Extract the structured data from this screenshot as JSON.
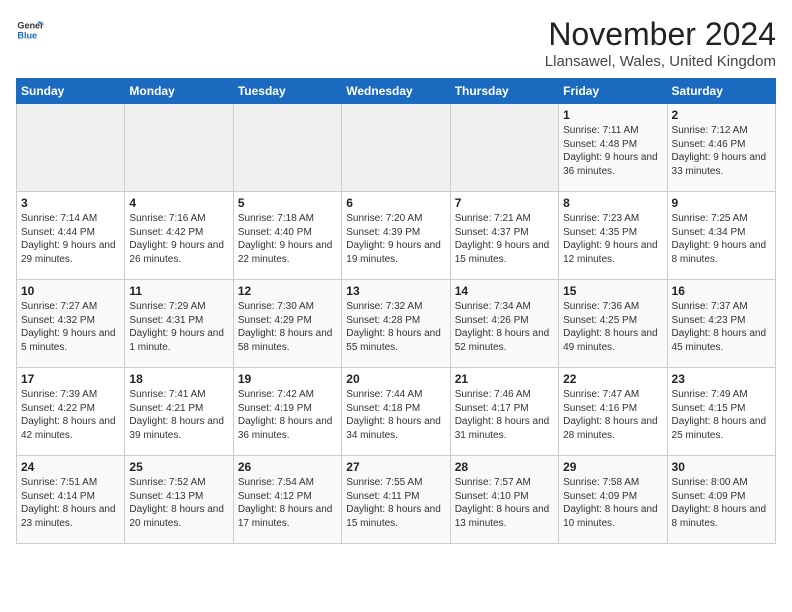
{
  "logo": {
    "general": "General",
    "blue": "Blue"
  },
  "title": "November 2024",
  "subtitle": "Llansawel, Wales, United Kingdom",
  "days_of_week": [
    "Sunday",
    "Monday",
    "Tuesday",
    "Wednesday",
    "Thursday",
    "Friday",
    "Saturday"
  ],
  "weeks": [
    [
      {
        "day": "",
        "detail": ""
      },
      {
        "day": "",
        "detail": ""
      },
      {
        "day": "",
        "detail": ""
      },
      {
        "day": "",
        "detail": ""
      },
      {
        "day": "",
        "detail": ""
      },
      {
        "day": "1",
        "detail": "Sunrise: 7:11 AM\nSunset: 4:48 PM\nDaylight: 9 hours and 36 minutes."
      },
      {
        "day": "2",
        "detail": "Sunrise: 7:12 AM\nSunset: 4:46 PM\nDaylight: 9 hours and 33 minutes."
      }
    ],
    [
      {
        "day": "3",
        "detail": "Sunrise: 7:14 AM\nSunset: 4:44 PM\nDaylight: 9 hours and 29 minutes."
      },
      {
        "day": "4",
        "detail": "Sunrise: 7:16 AM\nSunset: 4:42 PM\nDaylight: 9 hours and 26 minutes."
      },
      {
        "day": "5",
        "detail": "Sunrise: 7:18 AM\nSunset: 4:40 PM\nDaylight: 9 hours and 22 minutes."
      },
      {
        "day": "6",
        "detail": "Sunrise: 7:20 AM\nSunset: 4:39 PM\nDaylight: 9 hours and 19 minutes."
      },
      {
        "day": "7",
        "detail": "Sunrise: 7:21 AM\nSunset: 4:37 PM\nDaylight: 9 hours and 15 minutes."
      },
      {
        "day": "8",
        "detail": "Sunrise: 7:23 AM\nSunset: 4:35 PM\nDaylight: 9 hours and 12 minutes."
      },
      {
        "day": "9",
        "detail": "Sunrise: 7:25 AM\nSunset: 4:34 PM\nDaylight: 9 hours and 8 minutes."
      }
    ],
    [
      {
        "day": "10",
        "detail": "Sunrise: 7:27 AM\nSunset: 4:32 PM\nDaylight: 9 hours and 5 minutes."
      },
      {
        "day": "11",
        "detail": "Sunrise: 7:29 AM\nSunset: 4:31 PM\nDaylight: 9 hours and 1 minute."
      },
      {
        "day": "12",
        "detail": "Sunrise: 7:30 AM\nSunset: 4:29 PM\nDaylight: 8 hours and 58 minutes."
      },
      {
        "day": "13",
        "detail": "Sunrise: 7:32 AM\nSunset: 4:28 PM\nDaylight: 8 hours and 55 minutes."
      },
      {
        "day": "14",
        "detail": "Sunrise: 7:34 AM\nSunset: 4:26 PM\nDaylight: 8 hours and 52 minutes."
      },
      {
        "day": "15",
        "detail": "Sunrise: 7:36 AM\nSunset: 4:25 PM\nDaylight: 8 hours and 49 minutes."
      },
      {
        "day": "16",
        "detail": "Sunrise: 7:37 AM\nSunset: 4:23 PM\nDaylight: 8 hours and 45 minutes."
      }
    ],
    [
      {
        "day": "17",
        "detail": "Sunrise: 7:39 AM\nSunset: 4:22 PM\nDaylight: 8 hours and 42 minutes."
      },
      {
        "day": "18",
        "detail": "Sunrise: 7:41 AM\nSunset: 4:21 PM\nDaylight: 8 hours and 39 minutes."
      },
      {
        "day": "19",
        "detail": "Sunrise: 7:42 AM\nSunset: 4:19 PM\nDaylight: 8 hours and 36 minutes."
      },
      {
        "day": "20",
        "detail": "Sunrise: 7:44 AM\nSunset: 4:18 PM\nDaylight: 8 hours and 34 minutes."
      },
      {
        "day": "21",
        "detail": "Sunrise: 7:46 AM\nSunset: 4:17 PM\nDaylight: 8 hours and 31 minutes."
      },
      {
        "day": "22",
        "detail": "Sunrise: 7:47 AM\nSunset: 4:16 PM\nDaylight: 8 hours and 28 minutes."
      },
      {
        "day": "23",
        "detail": "Sunrise: 7:49 AM\nSunset: 4:15 PM\nDaylight: 8 hours and 25 minutes."
      }
    ],
    [
      {
        "day": "24",
        "detail": "Sunrise: 7:51 AM\nSunset: 4:14 PM\nDaylight: 8 hours and 23 minutes."
      },
      {
        "day": "25",
        "detail": "Sunrise: 7:52 AM\nSunset: 4:13 PM\nDaylight: 8 hours and 20 minutes."
      },
      {
        "day": "26",
        "detail": "Sunrise: 7:54 AM\nSunset: 4:12 PM\nDaylight: 8 hours and 17 minutes."
      },
      {
        "day": "27",
        "detail": "Sunrise: 7:55 AM\nSunset: 4:11 PM\nDaylight: 8 hours and 15 minutes."
      },
      {
        "day": "28",
        "detail": "Sunrise: 7:57 AM\nSunset: 4:10 PM\nDaylight: 8 hours and 13 minutes."
      },
      {
        "day": "29",
        "detail": "Sunrise: 7:58 AM\nSunset: 4:09 PM\nDaylight: 8 hours and 10 minutes."
      },
      {
        "day": "30",
        "detail": "Sunrise: 8:00 AM\nSunset: 4:09 PM\nDaylight: 8 hours and 8 minutes."
      }
    ]
  ]
}
